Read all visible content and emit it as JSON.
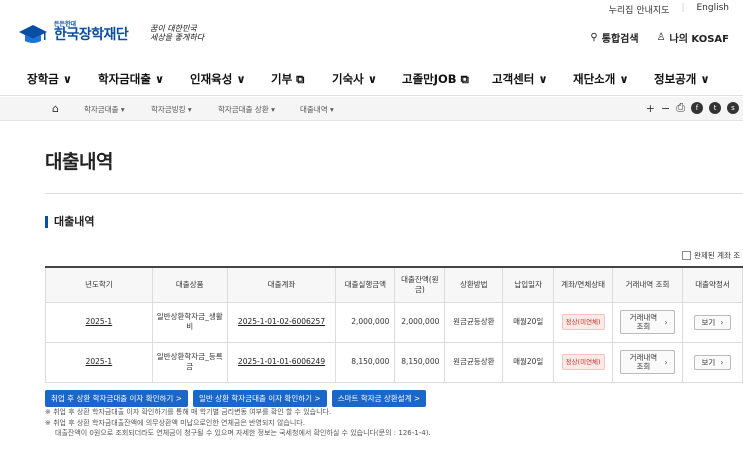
{
  "util_links": [
    "누리집 안내지도",
    "English"
  ],
  "logo": {
    "small_label": "든든한대",
    "name": "한국장학재단",
    "slogan_line1": "꿈이 대한민국",
    "slogan_line2": "세상을 좋게하다"
  },
  "header_links": [
    {
      "label": "통합검색",
      "icon": "search-icon"
    },
    {
      "label": "나의 KOSAF",
      "icon": "user-icon"
    }
  ],
  "gnb": [
    {
      "label": "장학금 ∨"
    },
    {
      "label": "학자금대출 ∨"
    },
    {
      "label": "인재육성 ∨"
    },
    {
      "label": "기부 ⧉"
    },
    {
      "label": "기숙사 ∨"
    },
    {
      "label": "고졸만JOB ⧉"
    },
    {
      "label": "고객센터 ∨"
    },
    {
      "label": "재단소개 ∨"
    },
    {
      "label": "정보공개 ∨"
    }
  ],
  "breadcrumb": [
    "학자금대출 ▾",
    "학자금빙킹 ▾",
    "학자금대출 상환 ▾",
    "대출내역 ▾"
  ],
  "page_title": "대출내역",
  "section_title": "대출내역",
  "option_label": "완제된 계좌 조",
  "table": {
    "headers": [
      "년도학기",
      "대출상품",
      "대출계좌",
      "대출실행금액",
      "대출잔액(원금)",
      "상환방법",
      "납입일자",
      "계좌/연체상태",
      "거래내역 조회",
      "대출약정서"
    ],
    "rows": [
      {
        "term": "2025-1",
        "product": "일반상환학자금_생활비",
        "account": "2025-1-01-02-6006257",
        "amount": "2,000,000",
        "balance": "2,000,000",
        "method": "원금균등상환",
        "due": "매월20일",
        "status": "정상(미연체)",
        "history_btn": "거래내역 조회",
        "view_btn": "보기"
      },
      {
        "term": "2025-1",
        "product": "일반상환학자금_등록금",
        "account": "2025-1-01-01-6006249",
        "amount": "8,150,000",
        "balance": "8,150,000",
        "method": "원금균등상환",
        "due": "매월20일",
        "status": "정상(미연체)",
        "history_btn": "거래내역 조회",
        "view_btn": "보기"
      }
    ]
  },
  "actions": [
    "취업 후 상환 학자금대출 이자 확인하기 >",
    "일반 상환 학자금대출 이자 확인하기 >",
    "스마트 학자금 상환설계 >"
  ],
  "notes": [
    "※ 취업 후 상환 학자금대출 이자 확인하기를 통해 매 학기별 금리변동 여부를 확인 할 수 있습니다.",
    "※ 취업 후 상환 학자금대출잔액에 의무상환액 미납으로인한 연체금은 반영되지 않습니다.",
    "대출잔액이 0원으로 조회되더라도 연체금이 청구될 수 있으며 자세한 정보는 국세청에서 확인하실 수 있습니다(문의 : 126-1-4)."
  ],
  "colors": {
    "brand": "#0a4ea3",
    "action": "#1a66c9",
    "status_text": "#c0392b"
  }
}
